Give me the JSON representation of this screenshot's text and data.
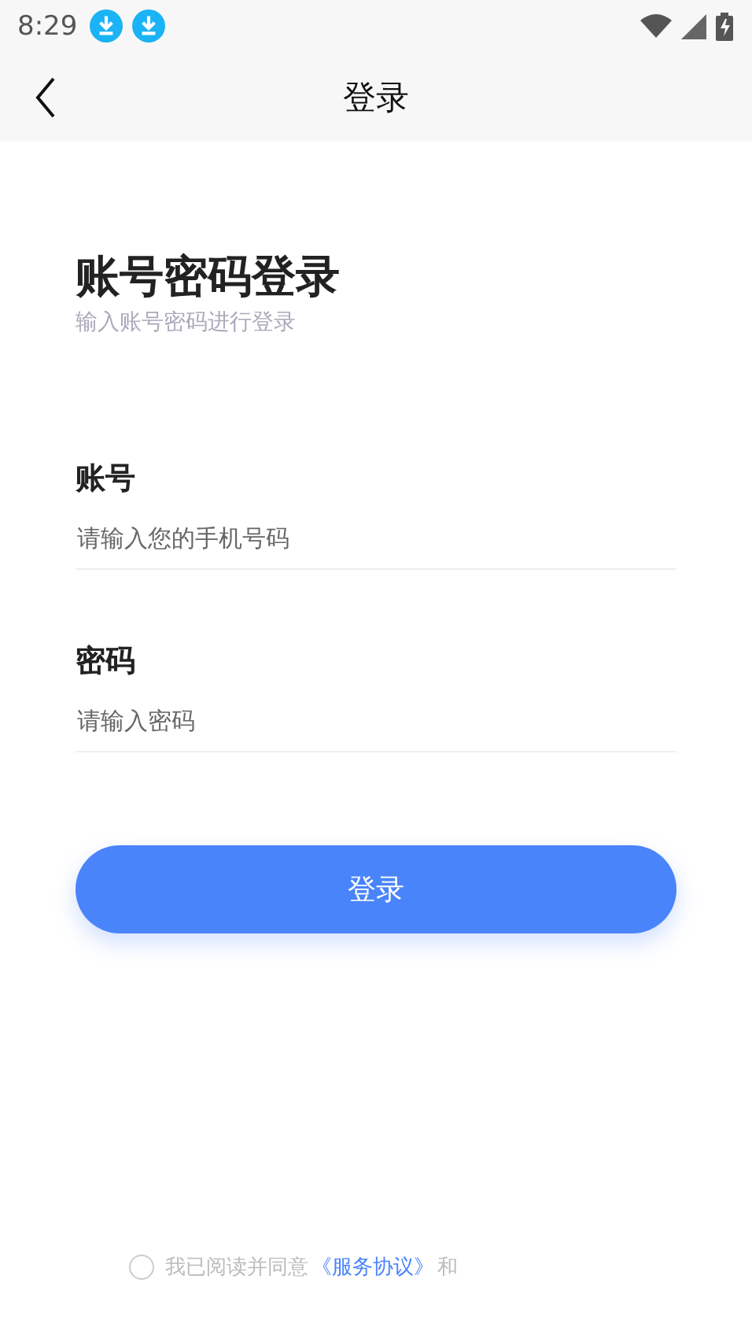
{
  "status_bar": {
    "time": "8:29"
  },
  "nav": {
    "title": "登录"
  },
  "heading": {
    "title": "账号密码登录",
    "subtitle": "输入账号密码进行登录"
  },
  "fields": [
    {
      "label": "账号",
      "placeholder": "请输入您的手机号码"
    },
    {
      "label": "密码",
      "placeholder": "请输入密码"
    }
  ],
  "submit": {
    "label": "登录"
  },
  "agreement": {
    "checked": false,
    "text": "我已阅读并同意",
    "link": "《服务协议》",
    "after": "和"
  }
}
